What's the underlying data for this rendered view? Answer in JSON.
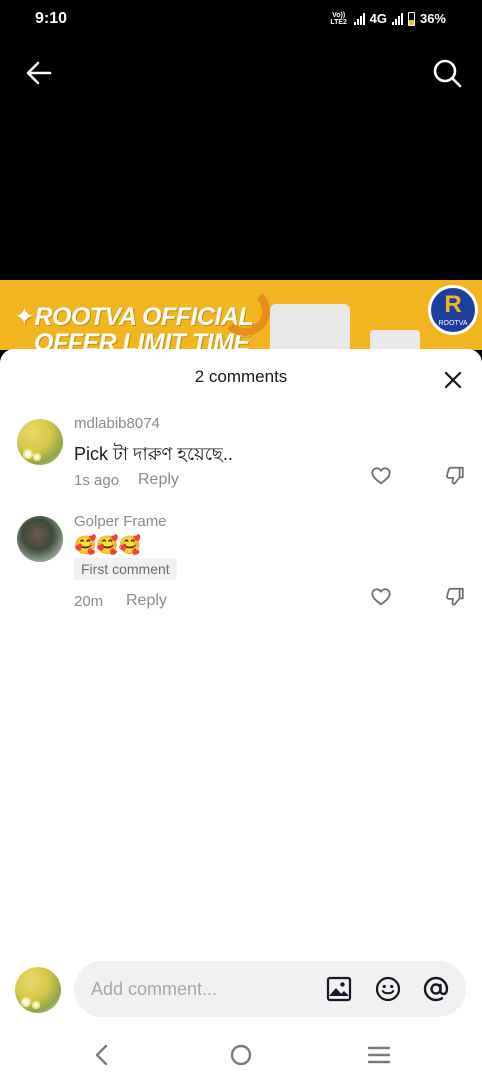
{
  "status_bar": {
    "time": "9:10",
    "volte_line1": "Vo))",
    "volte_line2": "LTE2",
    "network": "4G",
    "battery": "36%",
    "battery_level": 0.36
  },
  "banner": {
    "line1": "ROOTVA OFFICIAL",
    "line2": "OFFER LIMIT TIME",
    "logo_text": "ROOTVA",
    "background_color": "#f2b520"
  },
  "sheet": {
    "title": "2 comments"
  },
  "comments": [
    {
      "username": "mdlabib8074",
      "text": "Pick টা দারুণ হয়েছে..",
      "time": "1s ago",
      "reply_label": "Reply"
    },
    {
      "username": "Golper Frame",
      "text": "🥰🥰🥰",
      "badge": "First comment",
      "time": "20m",
      "reply_label": "Reply"
    }
  ],
  "input": {
    "placeholder": "Add comment..."
  },
  "icons": {
    "back": "arrow-left",
    "search": "magnifier",
    "close": "x",
    "like": "heart-outline",
    "dislike": "thumbs-down-outline",
    "image": "image",
    "emoji": "smiley",
    "mention": "at-sign"
  }
}
